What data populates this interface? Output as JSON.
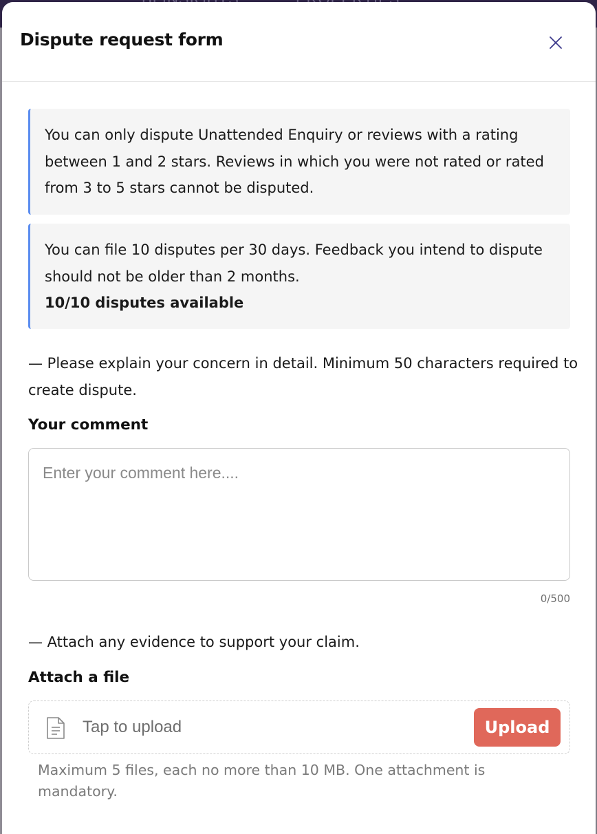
{
  "backdrop": {
    "tab_left": "BI INSIGHTS",
    "tab_right": "PROPERTIES"
  },
  "modal": {
    "title": "Dispute request form",
    "close_icon": "close-icon",
    "info_boxes": [
      {
        "text": "You can only dispute Unattended Enquiry or reviews with a rating between 1 and 2 stars. Reviews in which you were not rated or rated from 3 to 5 stars cannot be disputed."
      },
      {
        "text": "You can file 10 disputes per 30 days. Feedback you intend to dispute should not be older than 2 months.",
        "strong": "10/10 disputes available"
      }
    ],
    "comment_section": {
      "instruction": "— Please explain your concern in detail. Minimum 50 characters required to create dispute.",
      "label": "Your comment",
      "value": "",
      "placeholder": "Enter your comment here....",
      "char_count": "0/500"
    },
    "attach_section": {
      "instruction": "— Attach any evidence to support your claim.",
      "label": "Attach a file",
      "upload_placeholder": "Tap to upload",
      "upload_button": "Upload",
      "hint": "Maximum 5 files, each no more than 10 MB. One attachment is mandatory.",
      "file_icon": "file-icon"
    }
  },
  "colors": {
    "accent_border": "#5b8def",
    "upload_button": "#e0685a",
    "close_icon": "#3d3a8c"
  }
}
